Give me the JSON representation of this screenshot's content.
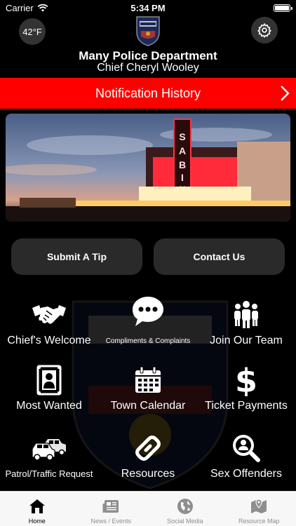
{
  "status_bar": {
    "carrier": "Carrier",
    "time": "5:34 PM"
  },
  "header": {
    "temperature": "42°F",
    "department": "Many Police Department",
    "chief": "Chief Cheryl Wooley"
  },
  "notification_bar": {
    "label": "Notification History"
  },
  "actions": {
    "submit_tip": "Submit A Tip",
    "contact_us": "Contact Us"
  },
  "grid": [
    {
      "label": "Chief's Welcome",
      "icon": "handshake-icon"
    },
    {
      "label": "Compliments & Complaints",
      "icon": "speech-bubble-icon"
    },
    {
      "label": "Join Our Team",
      "icon": "team-icon"
    },
    {
      "label": "Most Wanted",
      "icon": "portrait-icon"
    },
    {
      "label": "Town Calendar",
      "icon": "calendar-icon"
    },
    {
      "label": "Ticket Payments",
      "icon": "dollar-icon"
    },
    {
      "label": "Patrol/Traffic Request",
      "icon": "cars-icon"
    },
    {
      "label": "Resources",
      "icon": "link-icon"
    },
    {
      "label": "Sex Offenders",
      "icon": "magnifier-icon"
    }
  ],
  "tabs": [
    {
      "label": "Home",
      "icon": "home-icon"
    },
    {
      "label": "News / Events",
      "icon": "newspaper-icon"
    },
    {
      "label": "Social Media",
      "icon": "globe-icon"
    },
    {
      "label": "Resource Map",
      "icon": "map-icon"
    }
  ],
  "colors": {
    "accent_red": "#ff0000",
    "button_bg": "#2a2a2a",
    "tab_active": "#000000",
    "tab_inactive": "#8e8e8e"
  }
}
